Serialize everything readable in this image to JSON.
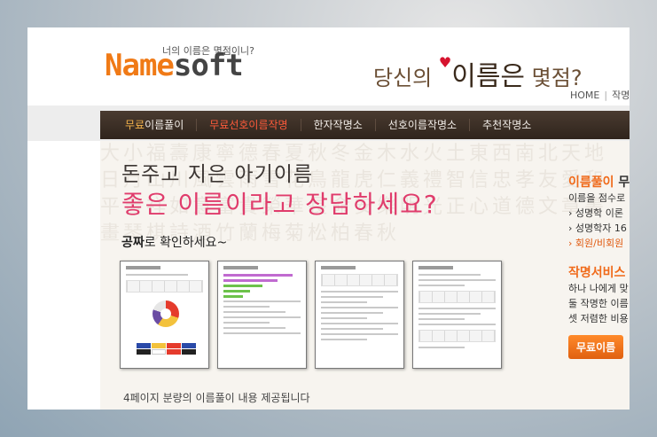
{
  "header": {
    "tagline": "너의 이름은 몇점이니?",
    "logo_a": "Name",
    "logo_b": "soft",
    "headline_pre": "당신의 ",
    "headline_big": "이름은",
    "headline_post": " 몇점?",
    "links": [
      "HOME",
      "작명서"
    ]
  },
  "nav": {
    "items": [
      {
        "pre": "무료",
        "main": "이름풀이"
      },
      {
        "pre": "",
        "main": "무료선호이름작명"
      },
      {
        "pre": "",
        "main": "한자작명소"
      },
      {
        "pre": "",
        "main": "선호이름작명소"
      },
      {
        "pre": "",
        "main": "추천작명소"
      }
    ]
  },
  "content": {
    "headline1": "돈주고 지은 아기이름",
    "headline2": "좋은 이름이라고 장담하세요?",
    "sub_bold": "공짜",
    "sub_rest": "로 확인하세요~",
    "caption": "4페이지 분량의 이름풀이 내용 제공됩니다",
    "background_text": "大小福壽康寧德春夏秋冬金木水火土東西南北天地日月山川風雲雨雪花鳥龍虎仁義禮智信忠孝友愛和平吉祥如意富貴榮華長命安樂明光正心道德文章書畫琴棋詩酒竹蘭梅菊松柏春秋"
  },
  "side": {
    "title_orange": "이름풀이",
    "title_dark": " 무",
    "lines": [
      "이름을 점수로",
      "› 성명학 이론",
      "› 성명학자 16"
    ],
    "link": "› 회원/비회원",
    "service_title": "작명서비스",
    "service_lines": [
      "하나 나에게 맞",
      "둘 작명한 이름",
      "셋 저렴한 비용"
    ],
    "button": "무료이름"
  },
  "colors": {
    "accent": "#f07a16",
    "pink": "#e03c6c",
    "nav_bg": "#3a2d24",
    "nav_active": "#ff5a3a"
  }
}
